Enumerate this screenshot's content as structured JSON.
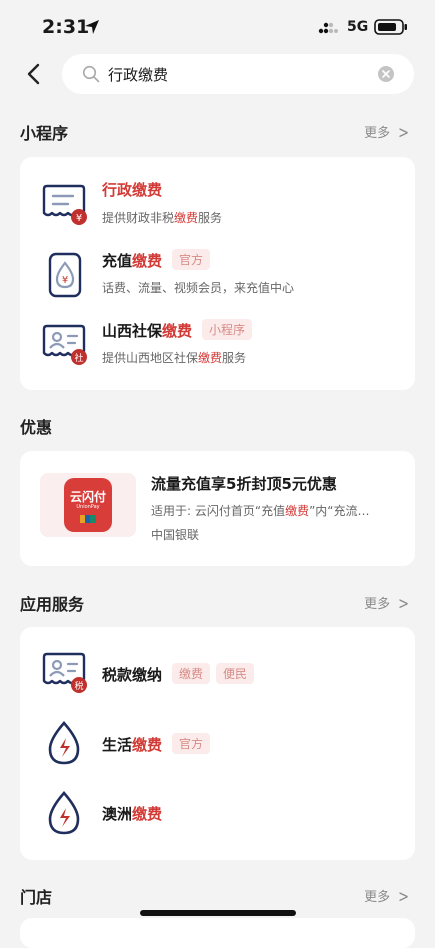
{
  "status": {
    "time": "2:31",
    "network": "5G"
  },
  "search": {
    "query": "行政缴费"
  },
  "sections": {
    "mini_programs": {
      "title": "小程序",
      "more": "更多"
    },
    "offers": {
      "title": "优惠"
    },
    "services": {
      "title": "应用服务",
      "more": "更多"
    },
    "stores": {
      "title": "门店",
      "more": "更多"
    }
  },
  "mini_programs": [
    {
      "pre": "",
      "hl": "行政缴费",
      "post": "",
      "tag": "",
      "desc_pre": "提供财政非税",
      "desc_hl": "缴费",
      "desc_post": "服务"
    },
    {
      "pre": "充值",
      "hl": "缴费",
      "post": "",
      "tag": "官方",
      "desc_pre": "话费、流量、视频会员，来充值中心",
      "desc_hl": "",
      "desc_post": ""
    },
    {
      "pre": "山西社保",
      "hl": "缴费",
      "post": "",
      "tag": "小程序",
      "desc_pre": "提供山西地区社保",
      "desc_hl": "缴费",
      "desc_post": "服务"
    }
  ],
  "offer": {
    "logo_text": "云闪付",
    "logo_sub": "UnionPay",
    "title": "流量充值享5折封顶5元优惠",
    "desc_pre": "适用于: 云闪付首页“充值",
    "desc_hl": "缴费",
    "desc_post": "”内“充流…",
    "issuer": "中国银联"
  },
  "services": [
    {
      "pre": "税款缴纳",
      "hl": "",
      "tags": [
        "缴费",
        "便民"
      ],
      "badge": "税"
    },
    {
      "pre": "生活",
      "hl": "缴费",
      "tags": [
        "官方"
      ]
    },
    {
      "pre": "澳洲",
      "hl": "缴费",
      "tags": []
    }
  ],
  "colors": {
    "accent": "#d23a36",
    "navy": "#1f2e5c",
    "badge": "#c0302c"
  },
  "icons": {
    "mp1": "receipt-yuan-icon",
    "mp2": "phone-recharge-icon",
    "mp3": "id-card-social-icon",
    "s1": "tax-id-card-icon",
    "s2": "utility-drop-icon",
    "s3": "utility-drop-icon"
  }
}
